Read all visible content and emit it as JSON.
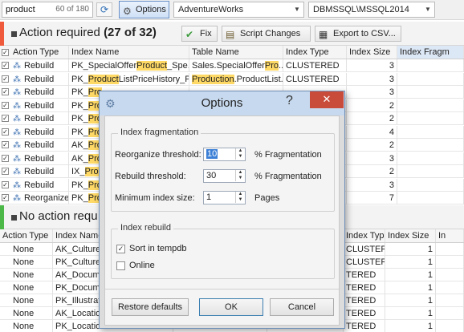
{
  "toolbar": {
    "search_value": "product",
    "search_count": "60 of 180",
    "options_label": "Options",
    "database": "AdventureWorks",
    "server": "DBMSSQL\\MSSQL2014"
  },
  "action_section": {
    "title_prefix": "Action required ",
    "title_count": "(27 of 32)",
    "fix_label": "Fix",
    "script_label": "Script Changes",
    "export_label": "Export to CSV...",
    "columns": [
      "Action Type",
      "Index Name",
      "Table Name",
      "Index Type",
      "Index Size",
      "Index Fragm"
    ],
    "rows": [
      {
        "action": "Rebuild",
        "index_pre": "PK_SpecialOffer",
        "index_hl": "Product",
        "index_post": "_Spe...",
        "table_pre": "Sales.SpecialOffer",
        "table_hl": "Pro",
        "table_post": "...",
        "type": "CLUSTERED",
        "size": "3"
      },
      {
        "action": "Rebuild",
        "index_pre": "PK_",
        "index_hl": "Product",
        "index_post": "ListPriceHistory_P...",
        "table_pre": "",
        "table_hl": "Production",
        "table_post": ".ProductList...",
        "type": "CLUSTERED",
        "size": "3"
      },
      {
        "action": "Rebuild",
        "index_pre": "PK_",
        "index_hl": "Pro",
        "index_post": "",
        "table_pre": "",
        "table_hl": "",
        "table_post": "",
        "type": "",
        "size": "3"
      },
      {
        "action": "Rebuild",
        "index_pre": "PK_",
        "index_hl": "Pro",
        "index_post": "",
        "table_pre": "",
        "table_hl": "",
        "table_post": "",
        "type": "",
        "size": "2"
      },
      {
        "action": "Rebuild",
        "index_pre": "PK_",
        "index_hl": "Pro",
        "index_post": "",
        "table_pre": "",
        "table_hl": "",
        "table_post": "",
        "type": "",
        "size": "2"
      },
      {
        "action": "Rebuild",
        "index_pre": "PK_",
        "index_hl": "Pro",
        "index_post": "",
        "table_pre": "",
        "table_hl": "",
        "table_post": "",
        "type": "",
        "size": "4"
      },
      {
        "action": "Rebuild",
        "index_pre": "AK_",
        "index_hl": "Pro",
        "index_post": "",
        "table_pre": "",
        "table_hl": "",
        "table_post": "",
        "type": "",
        "size": "2"
      },
      {
        "action": "Rebuild",
        "index_pre": "AK_",
        "index_hl": "Pro",
        "index_post": "",
        "table_pre": "",
        "table_hl": "",
        "table_post": "",
        "type": "",
        "size": "3"
      },
      {
        "action": "Rebuild",
        "index_pre": "IX_",
        "index_hl": "Pro",
        "index_post": "",
        "table_pre": "",
        "table_hl": "",
        "table_post": "",
        "type": "",
        "size": "2"
      },
      {
        "action": "Rebuild",
        "index_pre": "PK_",
        "index_hl": "Pro",
        "index_post": "",
        "table_pre": "",
        "table_hl": "",
        "table_post": "",
        "type": "",
        "size": "3"
      },
      {
        "action": "Reorganize",
        "index_pre": "PK_",
        "index_hl": "Pro",
        "index_post": "",
        "table_pre": "",
        "table_hl": "",
        "table_post": "",
        "type": "",
        "size": "7"
      }
    ]
  },
  "noaction_section": {
    "title": "No action requ",
    "columns": [
      "Action Type",
      "Index Name",
      "",
      "",
      "Index Type",
      "Index Size",
      "In"
    ],
    "rows": [
      {
        "action": "None",
        "index": "AK_Culture",
        "type": "CLUSTERED",
        "size": "1"
      },
      {
        "action": "None",
        "index": "PK_Culture",
        "type": "CLUSTERED",
        "size": "1"
      },
      {
        "action": "None",
        "index": "AK_Docume",
        "type": "TERED",
        "size": "1"
      },
      {
        "action": "None",
        "index": "PK_Docume",
        "type": "TERED",
        "size": "1"
      },
      {
        "action": "None",
        "index": "PK_Illustrat",
        "type": "TERED",
        "size": "1"
      },
      {
        "action": "None",
        "index": "AK_Location",
        "type": "TERED",
        "size": "1"
      },
      {
        "action": "None",
        "index": "PK_Location",
        "type": "TERED",
        "size": "1"
      }
    ]
  },
  "dialog": {
    "title": "Options",
    "help": "?",
    "close": "✕",
    "group_frag": "Index fragmentation",
    "reorg_label": "Reorganize threshold:",
    "reorg_value": "10",
    "reorg_unit": "% Fragmentation",
    "rebuild_label": "Rebuild threshold:",
    "rebuild_value": "30",
    "rebuild_unit": "% Fragmentation",
    "min_label": "Minimum index size:",
    "min_value": "1",
    "min_unit": "Pages",
    "group_rebuild": "Index rebuild",
    "sort_label": "Sort in tempdb",
    "sort_checked": true,
    "online_label": "Online",
    "online_checked": false,
    "restore_label": "Restore defaults",
    "ok_label": "OK",
    "cancel_label": "Cancel"
  },
  "colors": {
    "accent_red": "#f05a3c",
    "accent_green": "#4cb848",
    "highlight": "#ffd966",
    "close_red": "#c94b3a",
    "title_blue": "#c7d9ee"
  }
}
